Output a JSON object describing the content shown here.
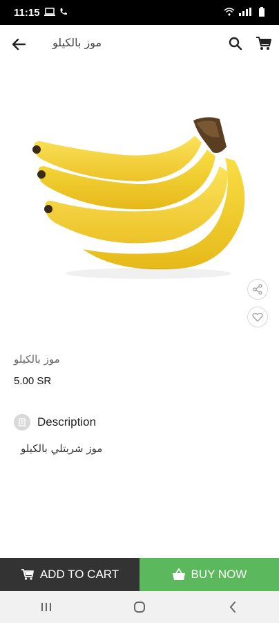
{
  "status_bar": {
    "time": "11:15"
  },
  "header": {
    "title": "موز بالكيلو"
  },
  "product": {
    "name": "موز بالكيلو",
    "price": "5.00 SR",
    "image_subject": "banana bunch"
  },
  "description": {
    "heading": "Description",
    "text": "موز شربتلي بالكيلو"
  },
  "actions": {
    "add_to_cart_label": "ADD TO CART",
    "buy_now_label": "BUY NOW"
  },
  "colors": {
    "add_to_cart_bg": "#333333",
    "buy_now_bg": "#5cb85c",
    "banana_yellow": "#f3cf2a"
  }
}
